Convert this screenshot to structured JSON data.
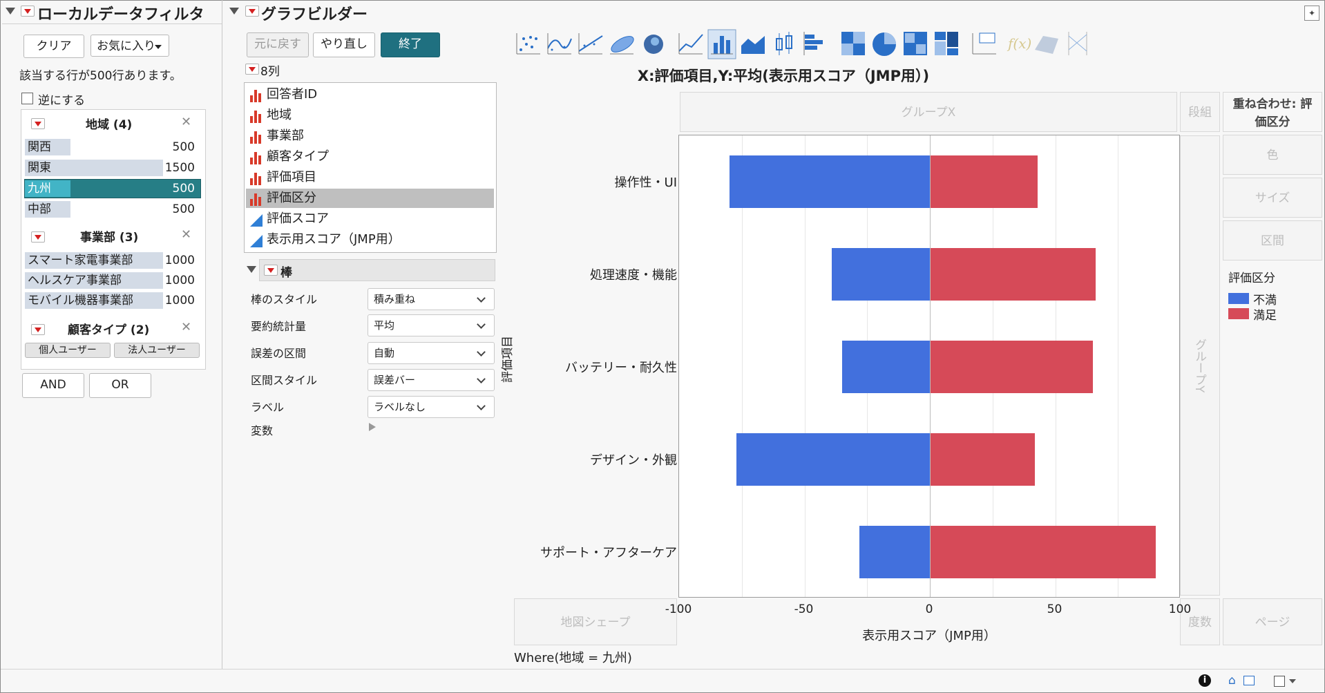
{
  "colors": {
    "neg": "#4270dd",
    "pos": "#d64a58",
    "accent": "#1f7080",
    "selected_row": "#267e86"
  },
  "left": {
    "title": "ローカルデータフィルタ",
    "clear": "クリア",
    "favorites": "お気に入り",
    "status": "該当する行が500行あります。",
    "invert": "逆にする",
    "groups": [
      {
        "title": "地域 (4)",
        "items": [
          {
            "name": "関西",
            "count": "500"
          },
          {
            "name": "関東",
            "count": "1500"
          },
          {
            "name": "九州",
            "count": "500"
          },
          {
            "name": "中部",
            "count": "500"
          }
        ]
      },
      {
        "title": "事業部 (3)",
        "items": [
          {
            "name": "スマート家電事業部",
            "count": "1000"
          },
          {
            "name": "ヘルスケア事業部",
            "count": "1000"
          },
          {
            "name": "モバイル機器事業部",
            "count": "1000"
          }
        ]
      },
      {
        "title": "顧客タイプ (2)",
        "buttons": [
          "個人ユーザー",
          "法人ユーザー"
        ]
      }
    ],
    "and": "AND",
    "or": "OR"
  },
  "builder": {
    "title": "グラフビルダー",
    "undo": "元に戻す",
    "redo": "やり直し",
    "done": "終了",
    "columns_label": "8列",
    "columns": [
      "回答者ID",
      "地域",
      "事業部",
      "顧客タイプ",
      "評価項目",
      "評価区分",
      "評価スコア",
      "表示用スコア（JMP用）"
    ],
    "bar_section": "棒",
    "props": [
      {
        "label": "棒のスタイル",
        "value": "積み重ね"
      },
      {
        "label": "要約統計量",
        "value": "平均"
      },
      {
        "label": "誤差の区間",
        "value": "自動"
      },
      {
        "label": "区間スタイル",
        "value": "誤差バー"
      },
      {
        "label": "ラベル",
        "value": "ラベルなし"
      }
    ],
    "variables_label": "変数"
  },
  "graph": {
    "title": "X:評価項目,Y:平均(表示用スコア（JMP用）)",
    "zones": {
      "group_x": "グループX",
      "wrap": "段組",
      "overlay": "重ね合わせ: 評価区分",
      "color": "色",
      "size": "サイズ",
      "interval": "区間",
      "group_y": "グループY",
      "map_shape": "地図シェープ",
      "freq": "度数",
      "page": "ページ"
    },
    "where": "Where(地域 = 九州)"
  },
  "chart_data": {
    "type": "bar",
    "orientation": "horizontal",
    "stacked": true,
    "categories": [
      "操作性・UI",
      "処理速度・機能",
      "バッテリー・耐久性",
      "デザイン・外観",
      "サポート・アフターケア"
    ],
    "series": [
      {
        "name": "不満",
        "values": [
          -80,
          -39,
          -35,
          -77,
          -28
        ]
      },
      {
        "name": "満足",
        "values": [
          43,
          66,
          65,
          42,
          90
        ]
      }
    ],
    "xlim": [
      -100,
      100
    ],
    "xticks": [
      "-100",
      "-50",
      "0",
      "50",
      "100"
    ],
    "xlabel": "表示用スコア（JMP用）",
    "ylabel": "評価項目",
    "legend_title": "評価区分",
    "legend_position": "right",
    "grid": true
  }
}
